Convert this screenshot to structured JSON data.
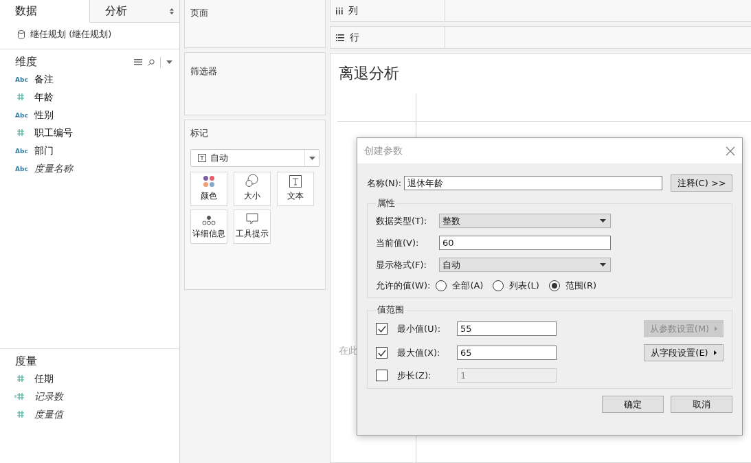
{
  "sidebar": {
    "tabs": [
      {
        "label": "数据",
        "selected": true
      },
      {
        "label": "分析",
        "selected": false
      }
    ],
    "datasource": "继任规划 (继任规划)",
    "dimensions": {
      "title": "维度",
      "fields": [
        {
          "kind": "string",
          "type_label": "Abc",
          "label": "备注",
          "italic": false
        },
        {
          "kind": "number",
          "label": "年龄",
          "italic": false
        },
        {
          "kind": "string",
          "type_label": "Abc",
          "label": "性别",
          "italic": false
        },
        {
          "kind": "number",
          "label": "职工编号",
          "italic": false
        },
        {
          "kind": "string",
          "type_label": "Abc",
          "label": "部门",
          "italic": false
        },
        {
          "kind": "string",
          "type_label": "Abc",
          "label": "度量名称",
          "italic": true
        }
      ]
    },
    "measures": {
      "title": "度量",
      "fields": [
        {
          "kind": "number",
          "label": "任期",
          "italic": false
        },
        {
          "kind": "calc-number",
          "label": "记录数",
          "italic": true
        },
        {
          "kind": "number",
          "label": "度量值",
          "italic": true
        }
      ]
    }
  },
  "shelves": {
    "pages": "页面",
    "filters": "筛选器",
    "marks": {
      "title": "标记",
      "type": "自动",
      "cards": [
        {
          "kind": "color",
          "label": "颜色"
        },
        {
          "kind": "size",
          "label": "大小"
        },
        {
          "kind": "text",
          "label": "文本"
        },
        {
          "kind": "detail",
          "label": "详细信息"
        },
        {
          "kind": "tooltip",
          "label": "工具提示"
        }
      ]
    }
  },
  "columns_shelf": "列",
  "rows_shelf": "行",
  "sheet": {
    "title": "离退分析",
    "drop_hint": "在此"
  },
  "dialog": {
    "title": "创建参数",
    "name_label": "名称(N):",
    "name_value": "退休年龄",
    "comment_button": "注释(C) >>",
    "properties": {
      "title": "属性",
      "data_type_label": "数据类型(T):",
      "data_type": "整数",
      "current_label": "当前值(V):",
      "current_value": "60",
      "format_label": "显示格式(F):",
      "format": "自动",
      "allowed_label": "允许的值(W):",
      "allowed": [
        {
          "label": "全部(A)",
          "selected": false
        },
        {
          "label": "列表(L)",
          "selected": false
        },
        {
          "label": "范围(R)",
          "selected": true
        }
      ]
    },
    "range": {
      "title": "值范围",
      "rows": [
        {
          "label": "最小值(U):",
          "checked": true,
          "value": "55",
          "disabled": false
        },
        {
          "label": "最大值(X):",
          "checked": true,
          "value": "65",
          "disabled": false
        },
        {
          "label": "步长(Z):",
          "checked": false,
          "value": "1",
          "disabled": true
        }
      ],
      "buttons": [
        {
          "label": "从参数设置(M)",
          "disabled": true
        },
        {
          "label": "从字段设置(E)",
          "disabled": false
        }
      ]
    },
    "ok": "确定",
    "cancel": "取消"
  }
}
